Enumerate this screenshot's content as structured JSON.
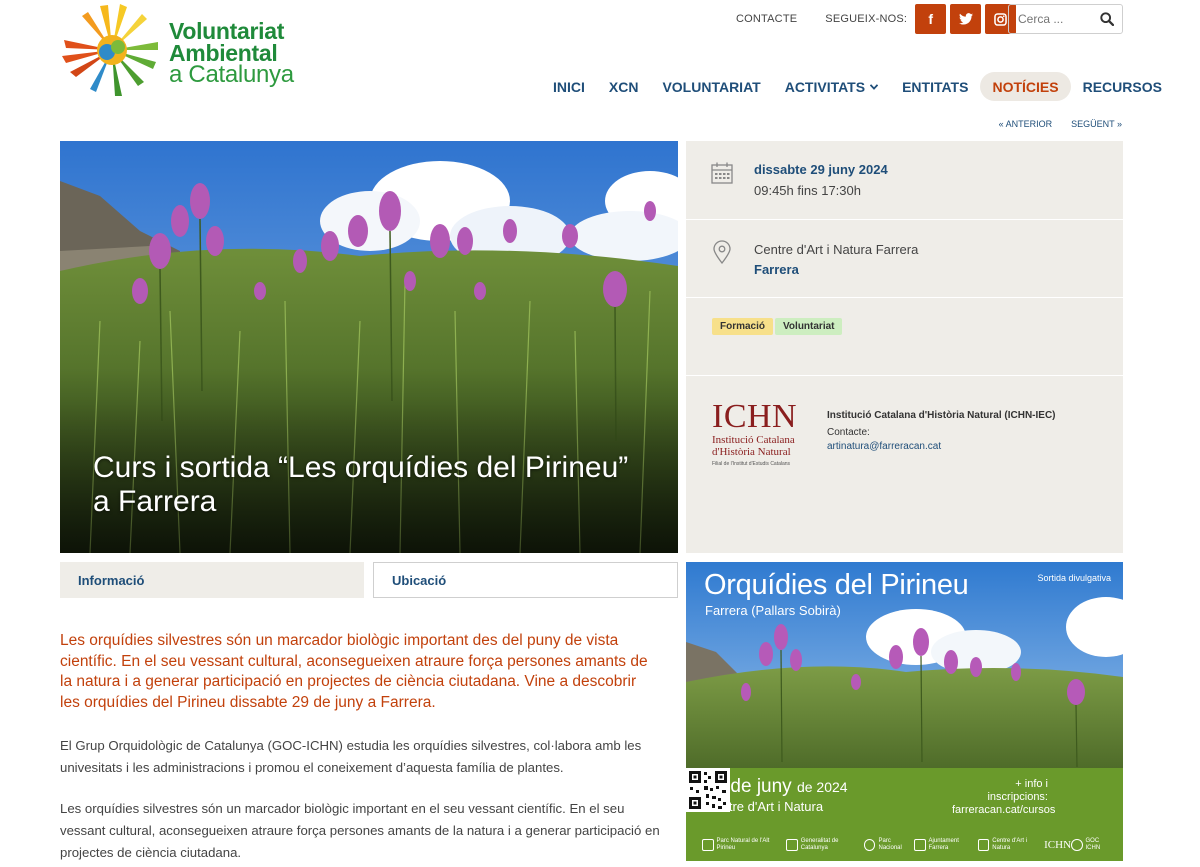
{
  "brand": {
    "line1": "Voluntariat",
    "line2": "Ambiental",
    "line3": "a Catalunya"
  },
  "top": {
    "contact": "CONTACTE",
    "follow": "SEGUEIX-NOS:",
    "social": [
      {
        "icon": "facebook-icon",
        "glyph": "f"
      },
      {
        "icon": "twitter-icon",
        "glyph": "t"
      },
      {
        "icon": "instagram-icon",
        "glyph": "◘"
      }
    ],
    "search_placeholder": "Cerca ..."
  },
  "nav": {
    "items": [
      {
        "label": "INICI"
      },
      {
        "label": "XCN"
      },
      {
        "label": "VOLUNTARIAT"
      },
      {
        "label": "ACTIVITATS"
      },
      {
        "label": "ENTITATS"
      },
      {
        "label": "NOTÍCIES"
      },
      {
        "label": "RECURSOS"
      }
    ],
    "active_index": 5
  },
  "pager": {
    "prev": "« ANTERIOR",
    "next": "SEGÜENT »"
  },
  "hero": {
    "title_line1": "Curs i sortida “Les orquídies del Pirineu”",
    "title_line2": "a Farrera"
  },
  "event": {
    "date": "dissabte 29 juny 2024",
    "time": "09:45h fins 17:30h",
    "venue": "Centre d'Art i Natura Farrera",
    "town": "Farrera",
    "tags": [
      "Formació",
      "Voluntariat"
    ],
    "org": {
      "logo_big": "ICHN",
      "logo_line1": "Institució Catalana",
      "logo_line2": "d'Història Natural",
      "logo_line3": "Filial de l'Institut d'Estudis Catalans",
      "name": "Institució Catalana d'Història Natural (ICHN-IEC)",
      "contact_label": "Contacte:",
      "email": "artinatura@farreracan.cat"
    }
  },
  "tabs": {
    "info": "Informació",
    "location": "Ubicació"
  },
  "content": {
    "intro": "Les orquídies silvestres són un marcador biològic important des del puny de vista científic. En el seu vessant cultural, aconsegueixen atraure força persones amants de la natura i a generar participació en projectes de ciència ciutadana. Vine a descobrir les orquídies del Pirineu dissabte 29 de juny a Farrera.",
    "p1": "El Grup Orquidològic de Catalunya (GOC-ICHN) estudia les orquídies silvestres, col·labora amb les univesitats i les administracions i promou el coneixement d’aquesta família de plantes.",
    "p2": "Les orquídies silvestres són un marcador biològic important en el seu vessant científic. En el seu vessant cultural, aconsegueixen atraure força persones amants de la natura i a generar participació en projectes de ciència ciutadana."
  },
  "poster": {
    "title": "Orquídies del Pirineu",
    "subtitle": "Farrera (Pallars Sobirà)",
    "tag": "Sortida divulgativa",
    "date": "29 de juny",
    "year": "de 2024",
    "venue": "Centre d'Art i Natura",
    "more_line1": "+ info i inscripcions:",
    "more_line2": "farreracan.cat/cursos",
    "logos": [
      {
        "name": "Parc Natural de l'Alt Pirineu"
      },
      {
        "name": "Generalitat de Catalunya"
      },
      {
        "name": "Parc Nacional"
      },
      {
        "name": "Ajuntament Farrera"
      },
      {
        "name": "Centre d'Art i Natura"
      },
      {
        "name": "ICHN"
      },
      {
        "name": "GOC ICHN"
      }
    ]
  },
  "colors": {
    "accent": "#c2410c",
    "navy": "#1f4e79",
    "green": "#1f8a3a",
    "panel": "#efede8"
  }
}
